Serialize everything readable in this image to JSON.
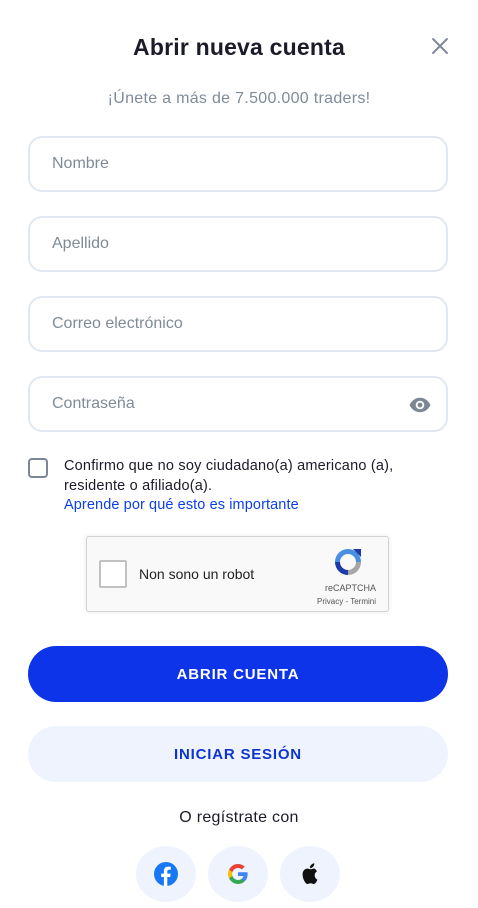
{
  "header": {
    "title": "Abrir nueva cuenta",
    "subtitle": "¡Únete a más de 7.500.000 traders!"
  },
  "form": {
    "first_name_placeholder": "Nombre",
    "last_name_placeholder": "Apellido",
    "email_placeholder": "Correo electrónico",
    "password_placeholder": "Contraseña",
    "first_name_value": "",
    "last_name_value": "",
    "email_value": "",
    "password_value": ""
  },
  "consent": {
    "checked": false,
    "text": "Confirmo que no soy ciudadano(a) americano (a), residente o afiliado(a).",
    "learn_more": "Aprende por qué esto es importante"
  },
  "recaptcha": {
    "label": "Non sono un robot",
    "brand": "reCAPTCHA",
    "privacy": "Privacy",
    "separator": " - ",
    "terms": "Termini"
  },
  "buttons": {
    "open_account": "ABRIR CUENTA",
    "sign_in": "INICIAR SESIÓN"
  },
  "social": {
    "label": "O regístrate con",
    "providers": [
      "facebook-icon",
      "google-icon",
      "apple-icon"
    ]
  },
  "colors": {
    "primary": "#0d34e8",
    "secondary_bg": "#eef3fd",
    "link": "#0d3fe8",
    "facebook": "#1877f2"
  }
}
